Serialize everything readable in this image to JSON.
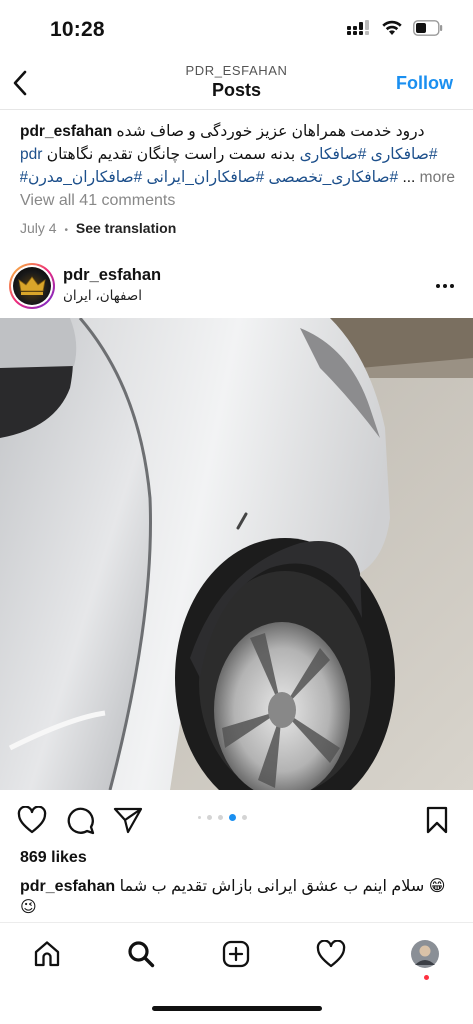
{
  "status_bar": {
    "time": "10:28"
  },
  "nav": {
    "subtitle": "PDR_ESFAHAN",
    "title": "Posts",
    "follow_label": "Follow"
  },
  "caption": {
    "username": "pdr_esfahan",
    "line1_text": "درود خدمت همراهان عزیز خوردگی و صاف شده",
    "line2_prefix": "pdr",
    "line2_text": "بدنه سمت راست چانگان تقدیم نگاهتان",
    "line2_tags": "#صافکاری #صافکاری",
    "line3_tags": "#صافکاری_تخصصی #صافکاران_ایرانی #صافکاران_مدرن#",
    "line3_ellipsis": "...",
    "more_label": "more",
    "view_comments": "View all 41 comments",
    "date": "July 4",
    "separator": "•",
    "see_translation": "See translation"
  },
  "post": {
    "username": "pdr_esfahan",
    "location": "اصفهان، ایران",
    "avatar_icon": "logo-crown-icon",
    "image_description_icon": "car-fender-photo",
    "carousel": {
      "count": 5,
      "active_index": 3
    },
    "likes": "869 likes",
    "top_comment": {
      "username": "pdr_esfahan",
      "text": "سلام اینم ب عشق ایرانی بازاش تقدیم ب شما",
      "emoji1": "😁",
      "emoji2": "😉"
    }
  },
  "tab_bar": {
    "items": [
      "home-icon",
      "search-icon",
      "create-icon",
      "activity-heart-icon",
      "profile-avatar"
    ]
  },
  "colors": {
    "accent": "#1a8ff0",
    "hashtag": "#1c4f8b",
    "notification": "#ff3040"
  }
}
